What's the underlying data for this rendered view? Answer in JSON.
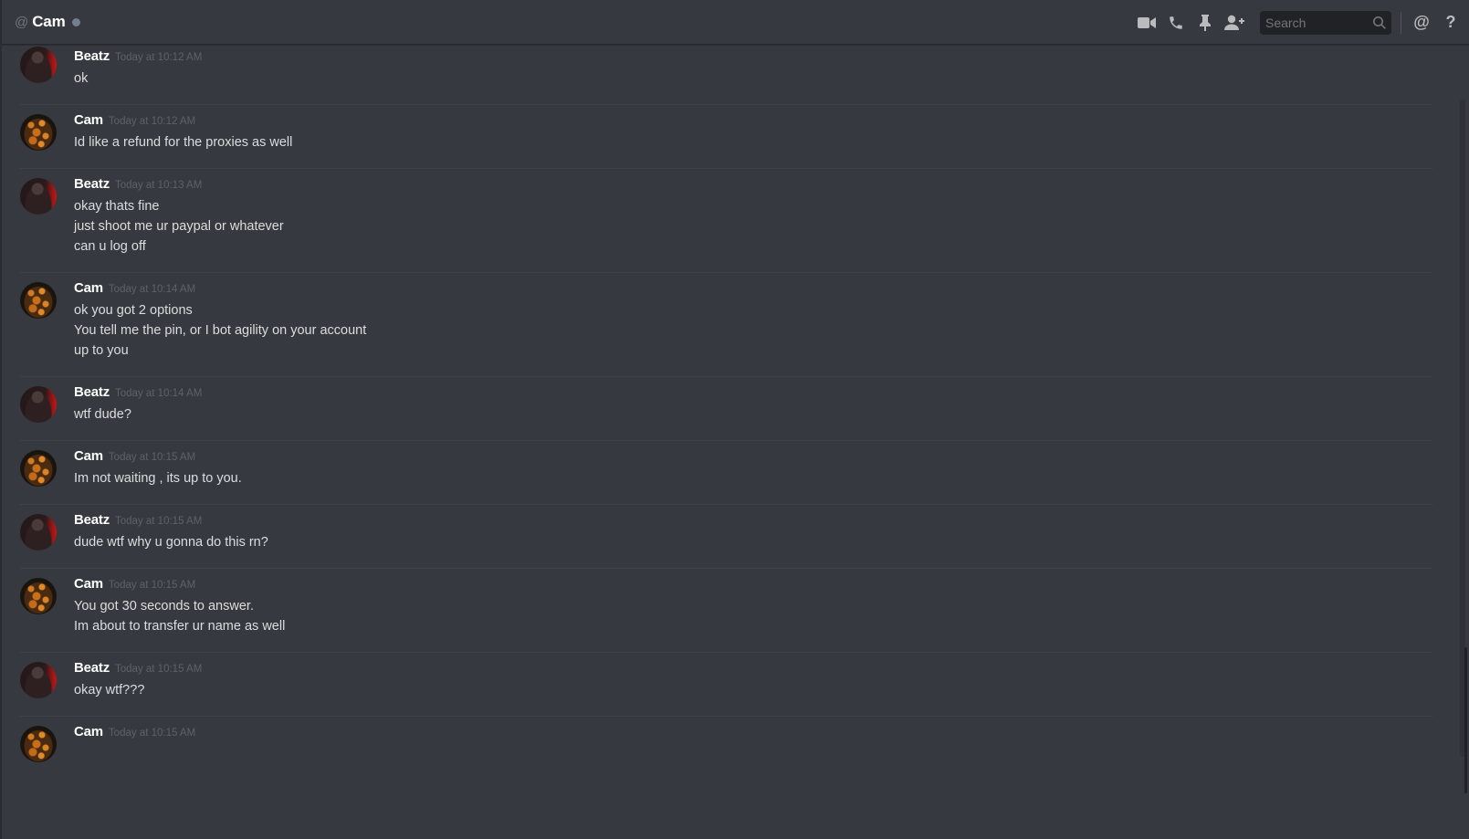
{
  "header": {
    "at_symbol": "@",
    "channel_name": "Cam",
    "status_color": "#747f8d"
  },
  "toolbar": {
    "icons": [
      "video-call-icon",
      "voice-call-icon",
      "pin-icon",
      "add-friend-icon",
      "mentions-icon",
      "help-icon"
    ],
    "mentions_label": "@",
    "help_label": "?"
  },
  "search": {
    "placeholder": "Search"
  },
  "messages": [
    {
      "author": "Beatz",
      "timestamp": "Today at 10:12 AM",
      "lines": [
        "ok"
      ]
    },
    {
      "author": "Cam",
      "timestamp": "Today at 10:12 AM",
      "lines": [
        "Id like a refund for the proxies as well"
      ]
    },
    {
      "author": "Beatz",
      "timestamp": "Today at 10:13 AM",
      "lines": [
        "okay thats fine",
        "just shoot me ur paypal or whatever",
        "can u log off"
      ]
    },
    {
      "author": "Cam",
      "timestamp": "Today at 10:14 AM",
      "lines": [
        "ok you got 2 options",
        "You tell me the pin, or I bot agility on your account",
        "up to you"
      ]
    },
    {
      "author": "Beatz",
      "timestamp": "Today at 10:14 AM",
      "lines": [
        "wtf dude?"
      ]
    },
    {
      "author": "Cam",
      "timestamp": "Today at 10:15 AM",
      "lines": [
        "Im not waiting , its up to you."
      ]
    },
    {
      "author": "Beatz",
      "timestamp": "Today at 10:15 AM",
      "lines": [
        "dude wtf why u gonna do this rn?"
      ]
    },
    {
      "author": "Cam",
      "timestamp": "Today at 10:15 AM",
      "lines": [
        "You got 30 seconds to answer.",
        "Im about to transfer ur name as well"
      ]
    },
    {
      "author": "Beatz",
      "timestamp": "Today at 10:15 AM",
      "lines": [
        "okay wtf???"
      ]
    },
    {
      "author": "Cam",
      "timestamp": "Today at 10:15 AM",
      "lines": []
    }
  ]
}
